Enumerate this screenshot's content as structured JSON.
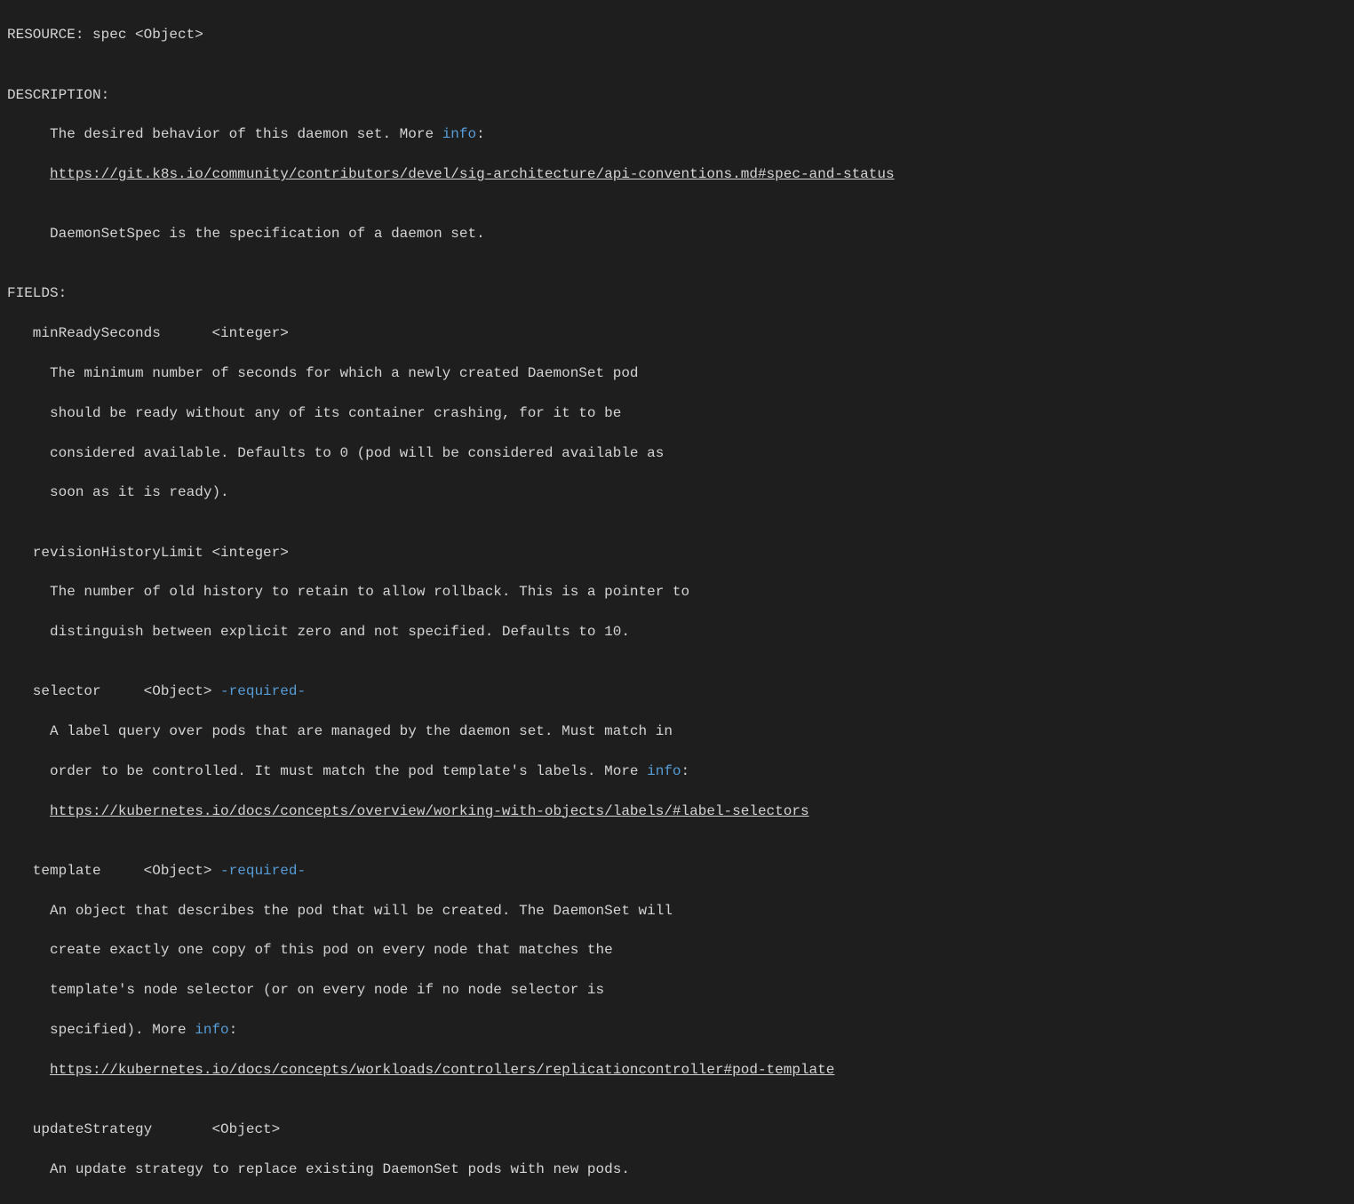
{
  "resource_line": "RESOURCE: spec <Object>",
  "description_header": "DESCRIPTION:",
  "description_line1_a": "     The desired behavior of this daemon set. More ",
  "description_line1_info": "info",
  "description_line1_b": ":",
  "description_link": "https://git.k8s.io/community/contributors/devel/sig-architecture/api-conventions.md#spec-and-status",
  "description_line2": "     DaemonSetSpec is the specification of a daemon set.",
  "fields_header": "FIELDS:",
  "f_minReady_name": "   minReadySeconds      <integer>",
  "f_minReady_d1": "     The minimum number of seconds for which a newly created DaemonSet pod",
  "f_minReady_d2": "     should be ready without any of its container crashing, for it to be",
  "f_minReady_d3": "     considered available. Defaults to 0 (pod will be considered available as",
  "f_minReady_d4": "     soon as it is ready).",
  "f_revHist_name": "   revisionHistoryLimit <integer>",
  "f_revHist_d1": "     The number of old history to retain to allow rollback. This is a pointer to",
  "f_revHist_d2": "     distinguish between explicit zero and not specified. Defaults to 10.",
  "f_selector_name_a": "   selector     <Object> ",
  "f_selector_required": "-required-",
  "f_selector_d1": "     A label query over pods that are managed by the daemon set. Must match in",
  "f_selector_d2_a": "     order to be controlled. It must match the pod template's labels. More ",
  "f_selector_d2_info": "info",
  "f_selector_d2_b": ":",
  "f_selector_link": "https://kubernetes.io/docs/concepts/overview/working-with-objects/labels/#label-selectors",
  "f_template_name_a": "   template     <Object> ",
  "f_template_required": "-required-",
  "f_template_d1": "     An object that describes the pod that will be created. The DaemonSet will",
  "f_template_d2": "     create exactly one copy of this pod on every node that matches the",
  "f_template_d3": "     template's node selector (or on every node if no node selector is",
  "f_template_d4_a": "     specified). More ",
  "f_template_d4_info": "info",
  "f_template_d4_b": ":",
  "f_template_link": "https://kubernetes.io/docs/concepts/workloads/controllers/replicationcontroller#pod-template",
  "f_update_name": "   updateStrategy       <Object>",
  "f_update_d1": "     An update strategy to replace existing DaemonSet pods with new pods.",
  "blank": "",
  "pad5": "     "
}
